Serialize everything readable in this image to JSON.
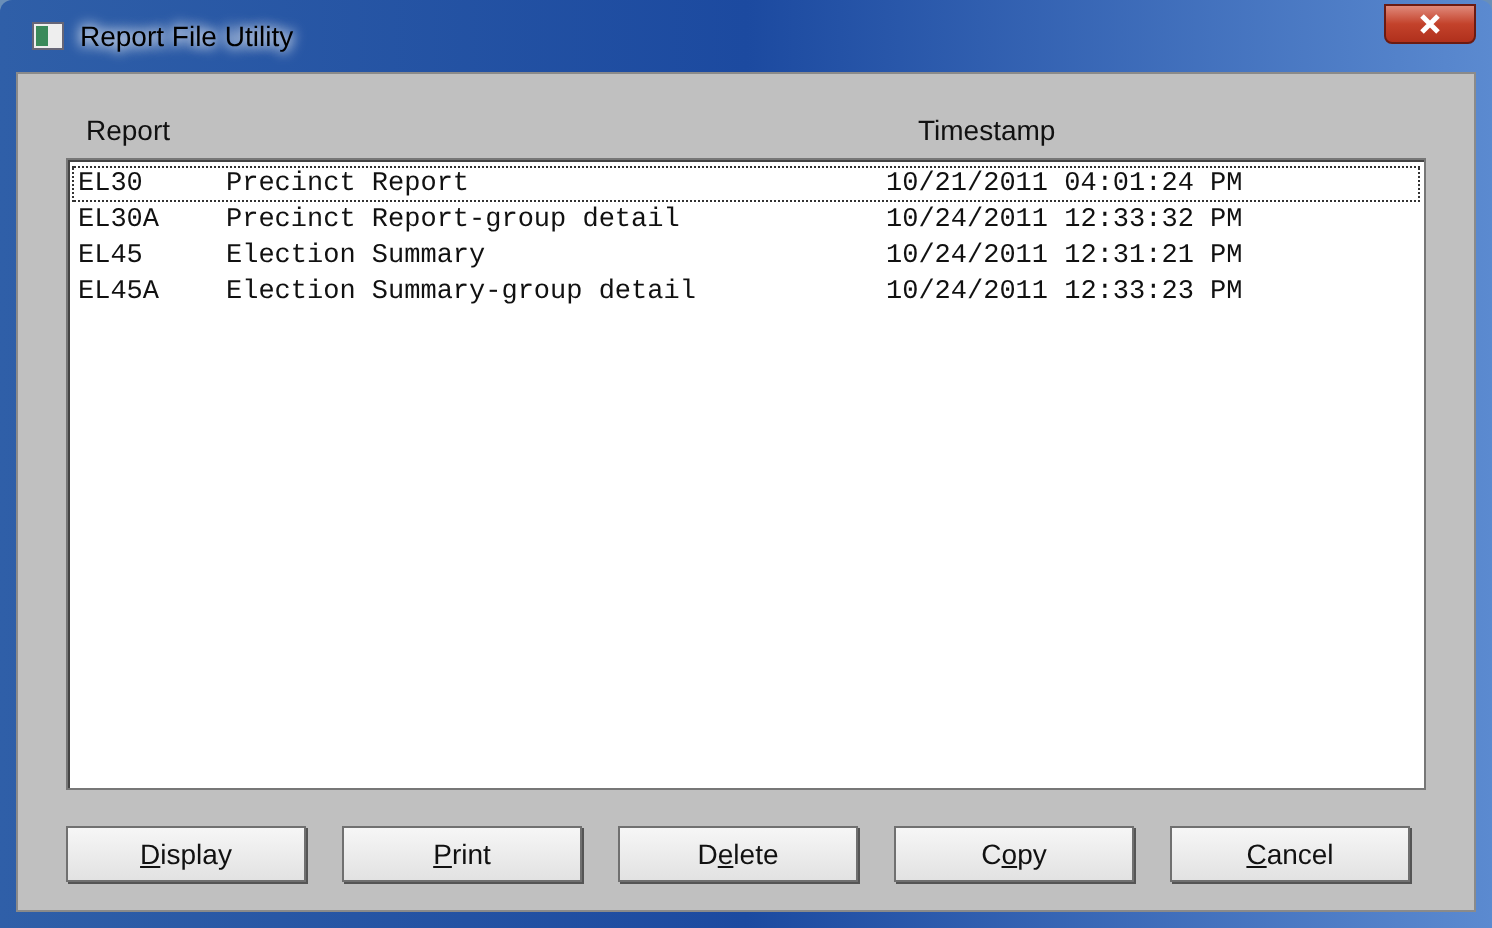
{
  "window": {
    "title": "Report File Utility"
  },
  "columns": [
    "Report",
    "Timestamp"
  ],
  "rows": [
    {
      "code": "EL30",
      "name": "Precinct Report",
      "timestamp": "10/21/2011 04:01:24 PM",
      "selected": true
    },
    {
      "code": "EL30A",
      "name": "Precinct Report-group detail",
      "timestamp": "10/24/2011 12:33:32 PM",
      "selected": false
    },
    {
      "code": "EL45",
      "name": "Election Summary",
      "timestamp": "10/24/2011 12:31:21 PM",
      "selected": false
    },
    {
      "code": "EL45A",
      "name": "Election Summary-group detail",
      "timestamp": "10/24/2011 12:33:23 PM",
      "selected": false
    }
  ],
  "buttons": [
    {
      "key": "D",
      "after": "isplay"
    },
    {
      "key": "P",
      "after": "rint"
    },
    {
      "before": "D",
      "key": "e",
      "after": "lete"
    },
    {
      "before": "C",
      "key": "o",
      "after": "py"
    },
    {
      "key": "C",
      "after": "ancel"
    }
  ]
}
